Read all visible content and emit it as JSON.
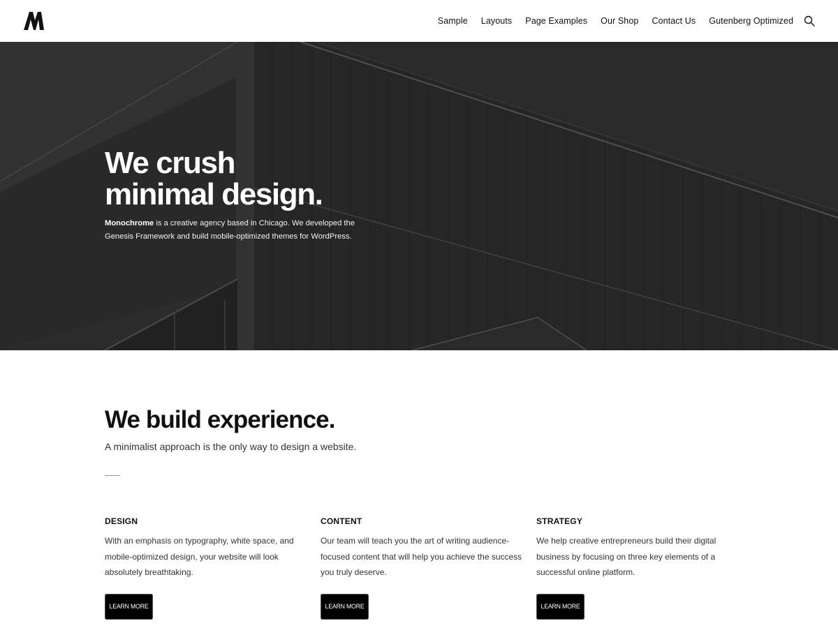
{
  "header": {
    "logo_alt": "M",
    "nav": [
      {
        "label": "Sample"
      },
      {
        "label": "Layouts"
      },
      {
        "label": "Page Examples"
      },
      {
        "label": "Our Shop"
      },
      {
        "label": "Contact Us"
      },
      {
        "label": "Gutenberg Optimized"
      }
    ],
    "search_icon": "search-icon"
  },
  "hero": {
    "title_line1": "We crush",
    "title_line2": "minimal design.",
    "brand": "Monochrome",
    "text": " is a creative agency based in Chicago. We developed the Genesis Framework and build mobile-optimized themes for WordPress."
  },
  "intro": {
    "title": "We build experience.",
    "subtitle": "A minimalist approach is the only way to design a website."
  },
  "features": [
    {
      "heading": "DESIGN",
      "text": "With an emphasis on typography, white space, and mobile-optimized design, your website will look absolutely breathtaking.",
      "button": "LEARN MORE"
    },
    {
      "heading": "CONTENT",
      "text": "Our team will teach you the art of writing audience-focused content that will help you achieve the success you truly deserve.",
      "button": "LEARN MORE"
    },
    {
      "heading": "STRATEGY",
      "text": "We help creative entrepreneurs build their digital business by focusing on three key elements of a successful online platform.",
      "button": "LEARN MORE"
    }
  ],
  "colors": {
    "background": "#ffffff",
    "hero_overlay": "#2b2b2b",
    "button": "#000000",
    "text": "#333333"
  }
}
